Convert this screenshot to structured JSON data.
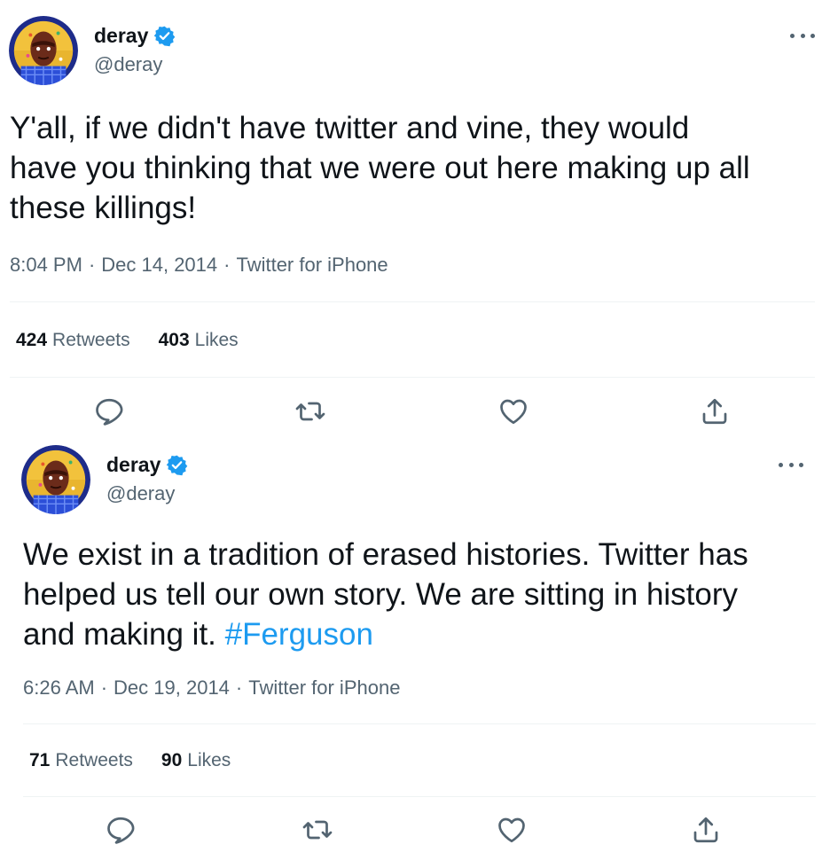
{
  "colors": {
    "text_primary": "#0f1419",
    "text_secondary": "#536471",
    "accent": "#1d9bf0",
    "divider": "#eff3f4"
  },
  "tweets": [
    {
      "display_name": "deray",
      "handle": "@deray",
      "verified": true,
      "text_lines": [
        "Y'all, if we didn't have twitter and vine, they would",
        "have you thinking that we were out here making up all",
        "these killings!"
      ],
      "time": "8:04 PM",
      "separator": "·",
      "date": "Dec 14, 2014",
      "source": "Twitter for iPhone",
      "retweets_count": "424",
      "retweets_label": "Retweets",
      "likes_count": "403",
      "likes_label": "Likes"
    },
    {
      "display_name": "deray",
      "handle": "@deray",
      "verified": true,
      "text_lines": [
        "We exist in a tradition of erased histories. Twitter has",
        "helped us tell our own story. We are sitting in history",
        "and making it. "
      ],
      "hashtag": "#Ferguson",
      "time": "6:26 AM",
      "separator": "·",
      "date": "Dec 19, 2014",
      "source": "Twitter for iPhone",
      "retweets_count": "71",
      "retweets_label": "Retweets",
      "likes_count": "90",
      "likes_label": "Likes"
    }
  ],
  "icons": {
    "verified": "verified-badge-icon",
    "more": "more-dots-icon",
    "reply": "reply-icon",
    "retweet": "retweet-icon",
    "like": "heart-icon",
    "share": "share-icon"
  }
}
